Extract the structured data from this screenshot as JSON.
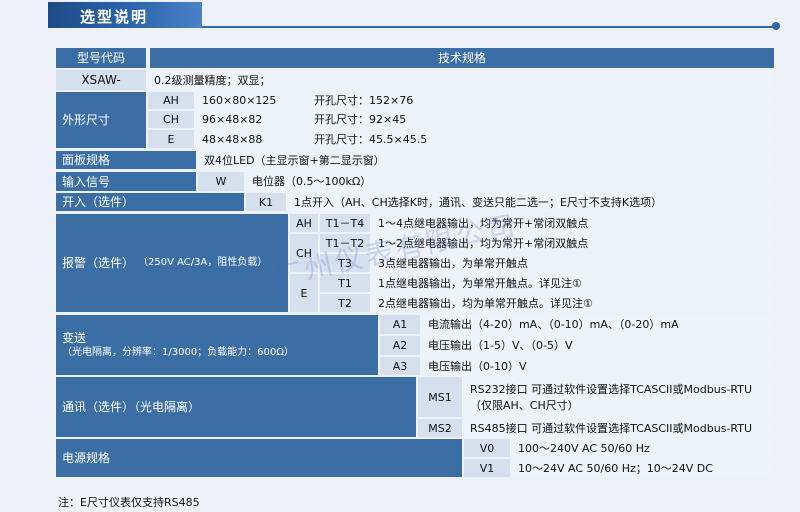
{
  "title": "选型说明",
  "header": {
    "col1": "型号代码",
    "col2": "技术规格"
  },
  "rows": {
    "xsaw": {
      "code": "XSAW-",
      "spec": "0.2级测量精度；双显；"
    },
    "shape": {
      "label": "外形尺寸",
      "items": [
        {
          "code": "AH",
          "size": "160×80×125",
          "hole": "开孔尺寸：152×76"
        },
        {
          "code": "CH",
          "size": "96×48×82",
          "hole": "开孔尺寸：92×45"
        },
        {
          "code": "E",
          "size": "48×48×88",
          "hole": "开孔尺寸：45.5×45.5"
        }
      ]
    },
    "panel": {
      "label": "面板规格",
      "spec": "双4位LED（主显示窗+第二显示窗）"
    },
    "input": {
      "label": "输入信号",
      "code": "W",
      "spec": "电位器（0.5～100kΩ）"
    },
    "switch_in": {
      "label": "开入（选件）",
      "code": "K1",
      "spec": "1点开入（AH、CH选择K时，通讯、变送只能二选一；E尺寸不支持K选项）"
    },
    "alarm": {
      "label": "报警（选件）",
      "note": "（250V AC/3A，阻性负载）",
      "groups": {
        "ah": "AH",
        "ch": "CH",
        "e": "E"
      },
      "items": [
        {
          "code": "T1－T4",
          "spec": "1～4点继电器输出，均为常开+常闭双触点"
        },
        {
          "code": "T1－T2",
          "spec": "1～2点继电器输出，均为常开+常闭双触点"
        },
        {
          "code": "T3",
          "spec": "3点继电器输出，为单常开触点"
        },
        {
          "code": "T1",
          "spec": "1点继电器输出，为单常开触点。详见注①"
        },
        {
          "code": "T2",
          "spec": "2点继电器输出，均为单常开触点。详见注①"
        }
      ]
    },
    "transmit": {
      "label": "变送",
      "note": "（光电隔离，分辨率：1/3000；负载能力：600Ω）",
      "items": [
        {
          "code": "A1",
          "spec": "电流输出（4-20）mA、（0-10）mA、（0-20）mA"
        },
        {
          "code": "A2",
          "spec": "电压输出（1-5）V、（0-5）V"
        },
        {
          "code": "A3",
          "spec": "电压输出（0-10）V"
        }
      ]
    },
    "comm": {
      "label": "通讯（选件）（光电隔离）",
      "items": [
        {
          "code": "MS1",
          "spec": "RS232接口  可通过软件设置选择TCASCII或Modbus-RTU",
          "spec2": "（仅限AH、CH尺寸）"
        },
        {
          "code": "MS2",
          "spec": "RS485接口  可通过软件设置选择TCASCII或Modbus-RTU"
        }
      ]
    },
    "power": {
      "label": "电源规格",
      "items": [
        {
          "code": "V0",
          "spec": "100～240V AC 50/60 Hz"
        },
        {
          "code": "V1",
          "spec": "10～24V AC 50/60 Hz；10～24V DC"
        }
      ]
    }
  },
  "footnote": "注：E尺寸仪表仅支持RS485",
  "watermark": "广州仪表有限公司"
}
